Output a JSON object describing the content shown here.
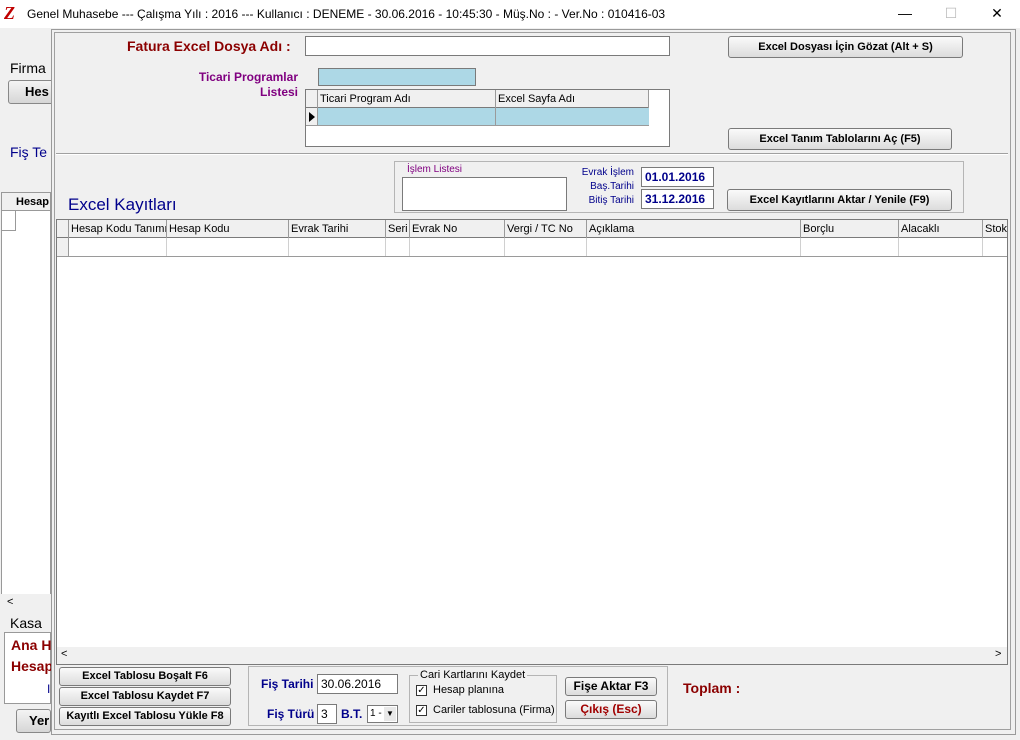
{
  "window": {
    "title": "Genel Muhasebe  ---  Çalışma Yılı : 2016  ---  Kullanıcı : DENEME - 30.06.2016 - 10:45:30 - Müş.No :  - Ver.No : 010416-03",
    "logo": "Z",
    "minimize": "—",
    "maximize": "☐",
    "close": "✕"
  },
  "background": {
    "firma": "Firma",
    "hes_button": "Hes",
    "fis_te": "Fiş Te",
    "hesap_col": "Hesap",
    "kasa": "Kasa",
    "ana_h": "Ana H",
    "hesap2": "Hesap",
    "yer_button": "Yer",
    "i_text": "I"
  },
  "dialog": {
    "file_label": "Fatura Excel Dosya Adı :",
    "file_value": "",
    "browse_button": "Excel Dosyası İçin Gözat (Alt + S)",
    "programs_label_line1": "Ticari Programlar",
    "programs_label_line2": "Listesi",
    "programs_input": "",
    "programs_grid": {
      "columns": [
        "Ticari Program Adı",
        "Excel Sayfa Adı"
      ]
    },
    "open_tables_button": "Excel Tanım Tablolarını Aç (F5)",
    "islem_listesi_label": "İşlem Listesi",
    "evrak_label_line1": "Evrak İşlem",
    "evrak_label_line2": "Baş.Tarihi",
    "evrak_label_line3": "Bitiş Tarihi",
    "start_date": "01.01.2016",
    "end_date": "31.12.2016",
    "transfer_button": "Excel Kayıtlarını Aktar / Yenile (F9)",
    "records_title": "Excel Kayıtları",
    "records_grid": {
      "columns": [
        "Hesap Kodu Tanımı",
        "Hesap Kodu",
        "Evrak Tarihi",
        "Seri",
        "Evrak No",
        "Vergi / TC No",
        "Açıklama",
        "Borçlu",
        "Alacaklı",
        "Stok"
      ]
    },
    "scroll_left": "<",
    "scroll_right": ">",
    "clear_button": "Excel Tablosu Boşalt F6",
    "save_button": "Excel Tablosu Kaydet F7",
    "load_button": "Kayıtlı Excel Tablosu Yükle F8",
    "fis_tarihi_label": "Fiş Tarihi",
    "fis_tarihi_value": "30.06.2016",
    "fis_turu_label": "Fiş Türü",
    "fis_turu_value": "3",
    "bt_label": "B.T.",
    "bt_value": "1 -",
    "cari_group_label": "Cari Kartlarını Kaydet",
    "hesap_plani_label": "Hesap planına",
    "cariler_label": "Cariler tablosuna (Firma)",
    "fise_aktar_button": "Fişe Aktar F3",
    "cikis_button": "Çıkış (Esc)",
    "toplam_label": "Toplam :"
  }
}
